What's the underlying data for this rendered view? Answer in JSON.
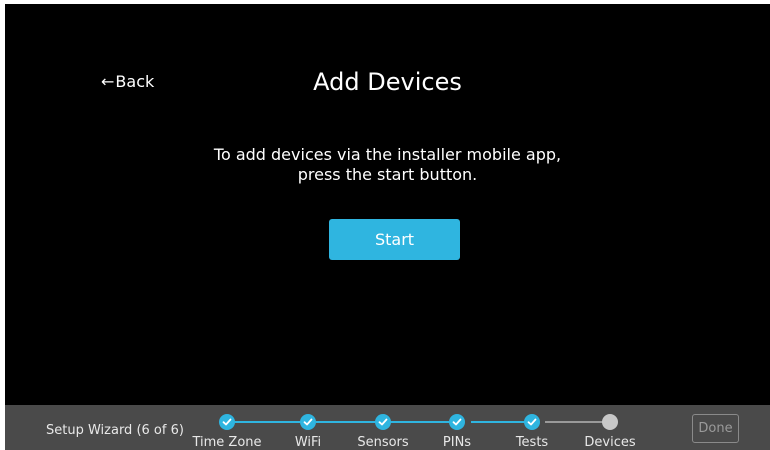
{
  "header": {
    "back_label": "Back",
    "back_arrow": "←",
    "title": "Add Devices"
  },
  "main": {
    "instruction_line1": "To add devices via the installer mobile app,",
    "instruction_line2": "press the start button.",
    "start_label": "Start"
  },
  "footer": {
    "wizard_label": "Setup Wizard (6 of 6)",
    "steps": [
      {
        "label": "Time Zone",
        "status": "complete"
      },
      {
        "label": "WiFi",
        "status": "complete"
      },
      {
        "label": "Sensors",
        "status": "complete"
      },
      {
        "label": "PINs",
        "status": "complete"
      },
      {
        "label": "Tests",
        "status": "complete"
      },
      {
        "label": "Devices",
        "status": "current"
      }
    ],
    "done_label": "Done"
  },
  "colors": {
    "accent": "#2fb5e0",
    "background": "#000000",
    "footer_background": "#4a4a4a",
    "current_step": "#c8c8c8"
  },
  "icons": {
    "back": "left-arrow-icon",
    "step_complete": "check-icon",
    "step_current": "dot-icon"
  }
}
